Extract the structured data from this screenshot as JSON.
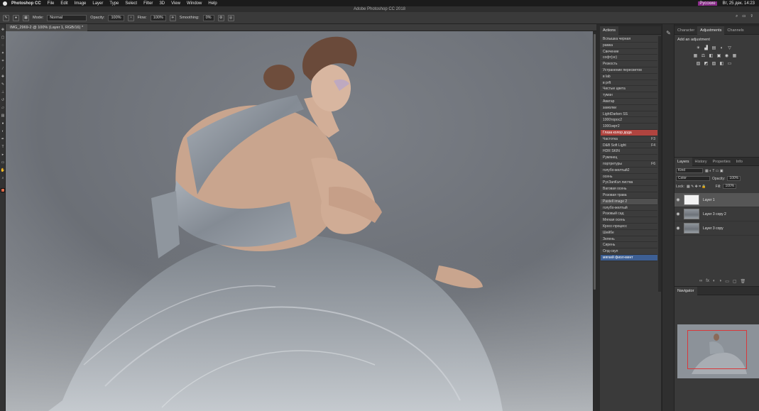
{
  "menubar": {
    "app": "Photoshop CC",
    "items": [
      "File",
      "Edit",
      "Image",
      "Layer",
      "Type",
      "Select",
      "Filter",
      "3D",
      "View",
      "Window",
      "Help"
    ],
    "status": "Вт, 25 дек. 14:23",
    "user": "Русские"
  },
  "window_title": "Adobe Photoshop CC 2018",
  "options": {
    "mode_label": "Mode:",
    "mode_value": "Normal",
    "opacity_label": "Opacity:",
    "opacity_value": "100%",
    "flow_label": "Flow:",
    "flow_value": "100%",
    "smoothing_label": "Smoothing:",
    "smoothing_value": "0%"
  },
  "document": {
    "tab_title": "IMG_2969-2 @ 100% (Layer 1, RGB/16) *"
  },
  "actions_panel": {
    "tab": "Actions",
    "items": [
      {
        "label": "Вспышка черная",
        "key": "",
        "state": ""
      },
      {
        "label": "рамка",
        "key": "",
        "state": ""
      },
      {
        "label": "Свечение",
        "key": "",
        "state": ""
      },
      {
        "label": "софт(эс)",
        "key": "",
        "state": ""
      },
      {
        "label": "Резкость",
        "key": "",
        "state": ""
      },
      {
        "label": "Устранение пересветов",
        "key": "",
        "state": ""
      },
      {
        "label": "в lab",
        "key": "",
        "state": ""
      },
      {
        "label": "в prft",
        "key": "",
        "state": ""
      },
      {
        "label": "Чистые цвета",
        "key": "",
        "state": ""
      },
      {
        "label": "туман",
        "key": "",
        "state": ""
      },
      {
        "label": "Аватар",
        "key": "",
        "state": ""
      },
      {
        "label": "замолки",
        "key": "",
        "state": ""
      },
      {
        "label": "LightDarken SS",
        "key": "",
        "state": ""
      },
      {
        "label": "1000торос2",
        "key": "",
        "state": ""
      },
      {
        "label": "1000экрт2",
        "key": "",
        "state": ""
      },
      {
        "label": "Глаза колор дода",
        "key": "",
        "state": "red"
      },
      {
        "label": "Частотка",
        "key": "F3",
        "state": ""
      },
      {
        "label": "D&B Soft Light",
        "key": "F4",
        "state": ""
      },
      {
        "label": "HDR SKIN",
        "key": "",
        "state": ""
      },
      {
        "label": "Румянец",
        "key": "",
        "state": ""
      },
      {
        "label": "портретуры",
        "key": "F6",
        "state": ""
      },
      {
        "label": "голубо-желтый2",
        "key": "",
        "state": ""
      },
      {
        "label": "осень",
        "key": "",
        "state": ""
      },
      {
        "label": "РусЗапКэл листва",
        "key": "",
        "state": ""
      },
      {
        "label": "Ваговая осень",
        "key": "",
        "state": ""
      },
      {
        "label": "Розовая трава",
        "key": "",
        "state": ""
      },
      {
        "label": "Pastell image 2",
        "key": "",
        "state": "grey"
      },
      {
        "label": "голубо-желтый",
        "key": "",
        "state": ""
      },
      {
        "label": "Розовый сад",
        "key": "",
        "state": ""
      },
      {
        "label": "Мягкая осень",
        "key": "",
        "state": ""
      },
      {
        "label": "Кросс-процесс",
        "key": "",
        "state": ""
      },
      {
        "label": "Шейбе",
        "key": "",
        "state": ""
      },
      {
        "label": "Зелень",
        "key": "",
        "state": ""
      },
      {
        "label": "Сирень",
        "key": "",
        "state": ""
      },
      {
        "label": "Олд-скул",
        "key": "",
        "state": ""
      },
      {
        "label": "мягкий фиол-мент",
        "key": "",
        "state": "blue"
      }
    ]
  },
  "adjustments_panel": {
    "tabs": [
      "Character",
      "Adjustments",
      "Channels"
    ],
    "active_tab": "Adjustments",
    "add_label": "Add an adjustment",
    "row1_icons": [
      "☀",
      "▟",
      "▤",
      "◐",
      "▽"
    ],
    "row2_icons": [
      "▦",
      "⚖",
      "◧",
      "▣",
      "◉",
      "▦"
    ],
    "row3_icons": [
      "▨",
      "◩",
      "▨",
      "◧",
      "▭"
    ]
  },
  "layers_panel": {
    "tabs": [
      "Layers",
      "History",
      "Properties",
      "Info"
    ],
    "active_tab": "Layers",
    "kind_filter": "Kind",
    "blend_mode": "Color",
    "opacity_label": "Opacity:",
    "opacity_value": "100%",
    "lock_label": "Lock:",
    "fill_label": "Fill:",
    "fill_value": "100%",
    "layers": [
      {
        "name": "Layer 1",
        "thumb": "white",
        "selected": true
      },
      {
        "name": "Layer 3 copy 2",
        "thumb": "photo",
        "selected": false
      },
      {
        "name": "Layer 3 copy",
        "thumb": "photo",
        "selected": false
      }
    ],
    "footer_icons": [
      "∞",
      "fx",
      "◐",
      "◑",
      "▭",
      "▢",
      "🗑"
    ]
  },
  "navigator_panel": {
    "tab": "Navigator"
  },
  "colors": {
    "accent_red": "#b0443f",
    "accent_blue": "#3d5f94",
    "foreground_swatch": "#d96a4a"
  }
}
